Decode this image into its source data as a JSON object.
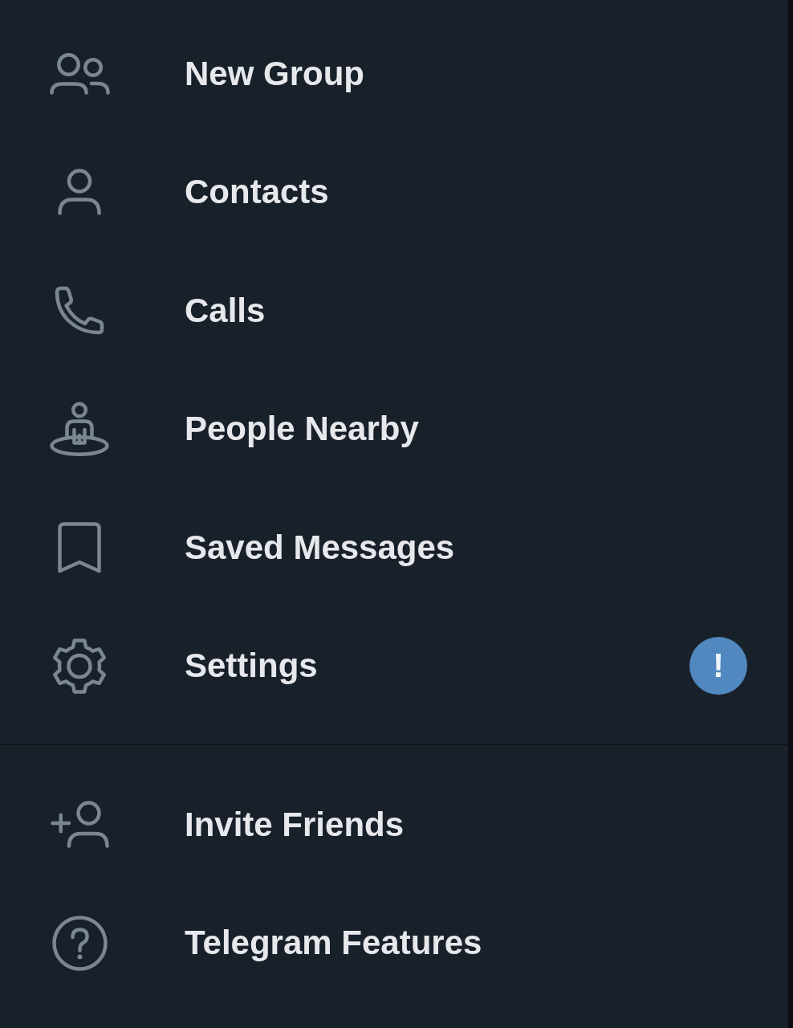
{
  "menu": {
    "sections": [
      {
        "items": [
          {
            "label": "New Group"
          },
          {
            "label": "Contacts"
          },
          {
            "label": "Calls"
          },
          {
            "label": "People Nearby"
          },
          {
            "label": "Saved Messages"
          },
          {
            "label": "Settings",
            "badge": "!"
          }
        ]
      },
      {
        "items": [
          {
            "label": "Invite Friends"
          },
          {
            "label": "Telegram Features"
          }
        ]
      }
    ]
  }
}
